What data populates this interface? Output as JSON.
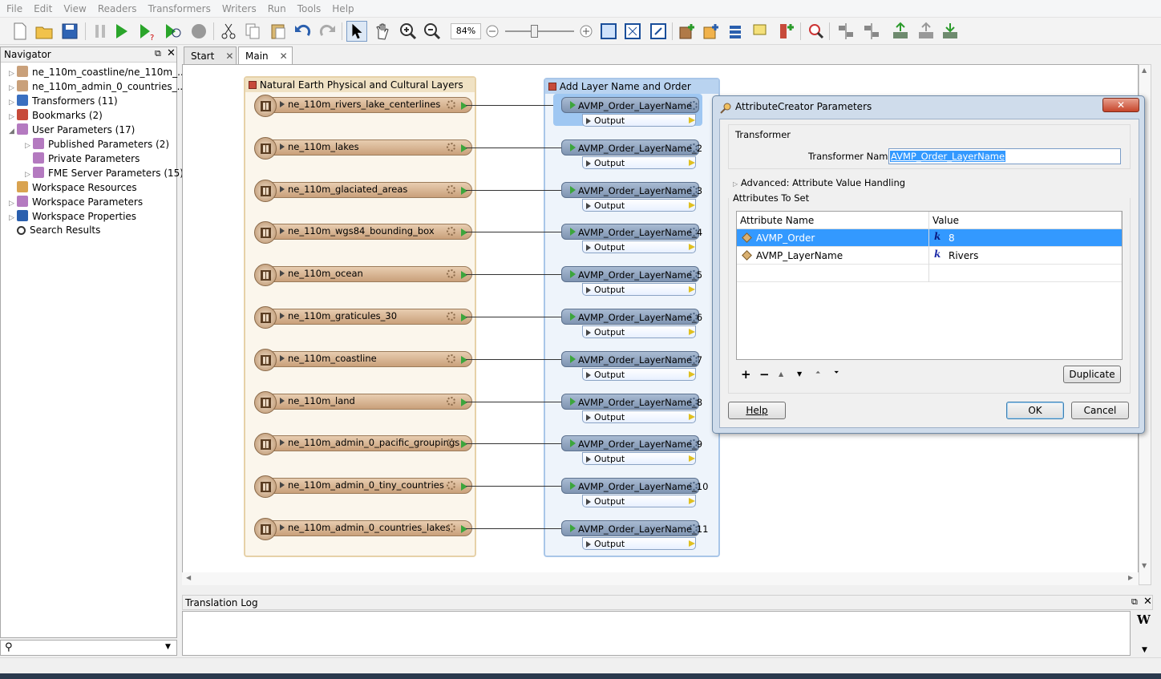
{
  "menu": [
    "File",
    "Edit",
    "View",
    "Readers",
    "Transformers",
    "Writers",
    "Run",
    "Tools",
    "Help"
  ],
  "toolbar": {
    "zoom": "84%"
  },
  "navigator": {
    "title": "Navigator",
    "items": [
      {
        "label": "ne_110m_coastline/ne_110m_...",
        "icon": "reader-icon",
        "level": 0,
        "expander": "▷"
      },
      {
        "label": "ne_110m_admin_0_countries_...",
        "icon": "reader-icon",
        "level": 0,
        "expander": "▷"
      },
      {
        "label": "Transformers (11)",
        "icon": "transformers-icon",
        "level": 0,
        "expander": "▷"
      },
      {
        "label": "Bookmarks (2)",
        "icon": "bookmark-icon",
        "level": 0,
        "expander": "▷"
      },
      {
        "label": "User Parameters (17)",
        "icon": "gear-icon",
        "level": 0,
        "expander": "◢"
      },
      {
        "label": "Published Parameters (2)",
        "icon": "gear-icon",
        "level": 1,
        "expander": "▷"
      },
      {
        "label": "Private Parameters",
        "icon": "gear-icon",
        "level": 1,
        "expander": ""
      },
      {
        "label": "FME Server Parameters (15)",
        "icon": "gear-icon",
        "level": 1,
        "expander": "▷"
      },
      {
        "label": "Workspace Resources",
        "icon": "folder-icon",
        "level": 0,
        "expander": ""
      },
      {
        "label": "Workspace Parameters",
        "icon": "gear-icon",
        "level": 0,
        "expander": "▷"
      },
      {
        "label": "Workspace Properties",
        "icon": "info-icon",
        "level": 0,
        "expander": "▷"
      },
      {
        "label": "Search Results",
        "icon": "search-icon",
        "level": 0,
        "expander": ""
      }
    ]
  },
  "tabs": [
    {
      "label": "Start"
    },
    {
      "label": "Main"
    }
  ],
  "bookmarks": {
    "left": "Natural Earth Physical and Cultural Layers",
    "right": "Add Layer Name and Order"
  },
  "readers": [
    "ne_110m_rivers_lake_centerlines",
    "ne_110m_lakes",
    "ne_110m_glaciated_areas",
    "ne_110m_wgs84_bounding_box",
    "ne_110m_ocean",
    "ne_110m_graticules_30",
    "ne_110m_coastline",
    "ne_110m_land",
    "ne_110m_admin_0_pacific_groupings",
    "ne_110m_admin_0_tiny_countries",
    "ne_110m_admin_0_countries_lakes"
  ],
  "transformers": [
    "AVMP_Order_LayerName",
    "AVMP_Order_LayerName_2",
    "AVMP_Order_LayerName_3",
    "AVMP_Order_LayerName_4",
    "AVMP_Order_LayerName_5",
    "AVMP_Order_LayerName_6",
    "AVMP_Order_LayerName_7",
    "AVMP_Order_LayerName_8",
    "AVMP_Order_LayerName_9",
    "AVMP_Order_LayerName_10",
    "AVMP_Order_LayerName_11"
  ],
  "output_label": "Output",
  "log": {
    "title": "Translation Log"
  },
  "dialog": {
    "title": "AttributeCreator Parameters",
    "transformer_group": "Transformer",
    "name_label": "Transformer Name:",
    "name_value": "AVMP_Order_LayerName",
    "advanced": "Advanced: Attribute Value Handling",
    "attrs_group": "Attributes To Set",
    "col_name": "Attribute Name",
    "col_value": "Value",
    "rows": [
      {
        "name": "AVMP_Order",
        "value": "8"
      },
      {
        "name": "AVMP_LayerName",
        "value": "Rivers"
      }
    ],
    "duplicate": "Duplicate",
    "help": "Help",
    "ok": "OK",
    "cancel": "Cancel"
  }
}
